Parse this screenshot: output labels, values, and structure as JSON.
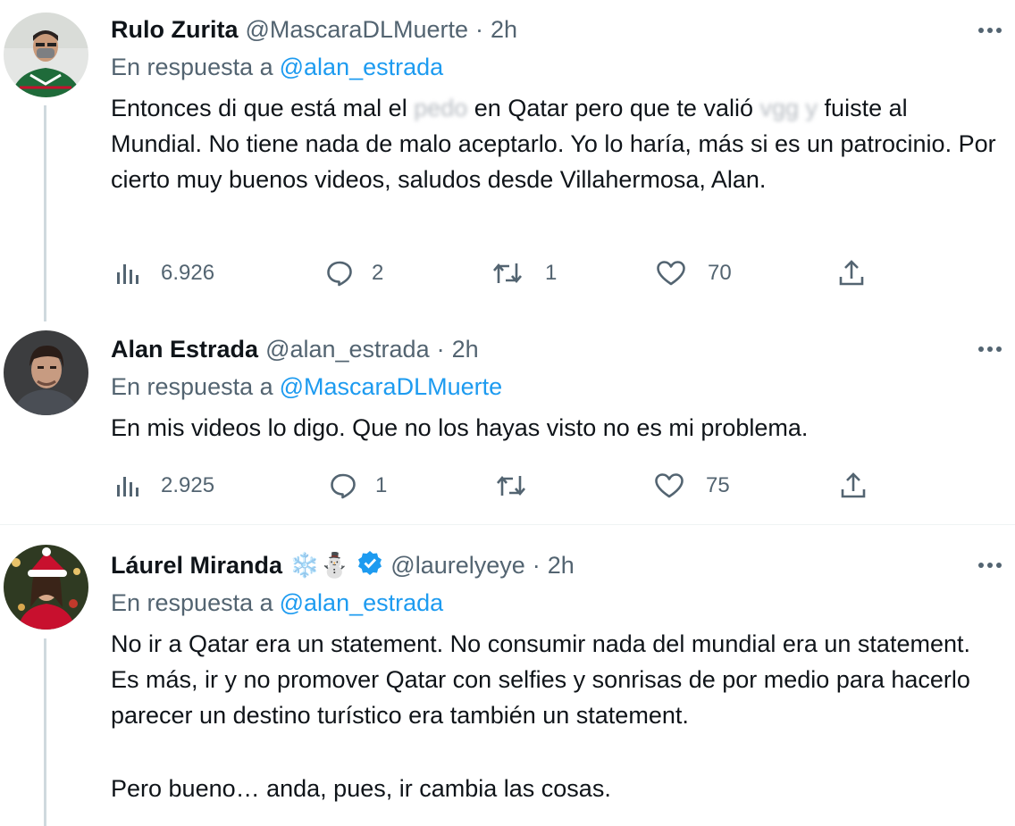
{
  "tweets": [
    {
      "name": "Rulo Zurita",
      "handle": "@MascaraDLMuerte",
      "time": "2h",
      "reply_prefix": "En respuesta a",
      "reply_to": "@alan_estrada",
      "text_parts": [
        "Entonces di que está mal el ",
        "pedo",
        " en Qatar pero que te valió ",
        "vgg y",
        " fuiste al Mundial. No tiene nada de malo aceptarlo. Yo lo haría, más si es un patrocinio. Por cierto muy buenos videos, saludos desde Villahermosa, Alan."
      ],
      "views": "6.926",
      "replies": "2",
      "retweets": "1",
      "likes": "70"
    },
    {
      "name": "Alan Estrada",
      "handle": "@alan_estrada",
      "time": "2h",
      "reply_prefix": "En respuesta a",
      "reply_to": "@MascaraDLMuerte",
      "text": "En mis videos lo digo. Que no los hayas visto no es mi problema.",
      "views": "2.925",
      "replies": "1",
      "retweets": "",
      "likes": "75"
    },
    {
      "name": "Láurel Miranda",
      "name_emojis": "❄️⛄",
      "handle": "@laurelyeye",
      "time": "2h",
      "reply_prefix": "En respuesta a",
      "reply_to": "@alan_estrada",
      "text_p1": "No ir a Qatar era un statement. No consumir nada del mundial era un statement. Es más, ir y no promover Qatar con selfies y sonrisas de por medio para hacerlo parecer un destino turístico era también un statement.",
      "text_p2": "Pero bueno… anda, pues, ir cambia las cosas."
    }
  ],
  "icons": {
    "views": "views-icon",
    "reply": "reply-icon",
    "retweet": "retweet-icon",
    "like": "like-icon",
    "share": "share-icon",
    "more": "more-icon",
    "verified": "verified-badge-icon"
  },
  "colors": {
    "text": "#0f1419",
    "secondary": "#536471",
    "link": "#1d9bf0",
    "thread_line": "#cfd9de",
    "divider": "#eff3f4"
  }
}
